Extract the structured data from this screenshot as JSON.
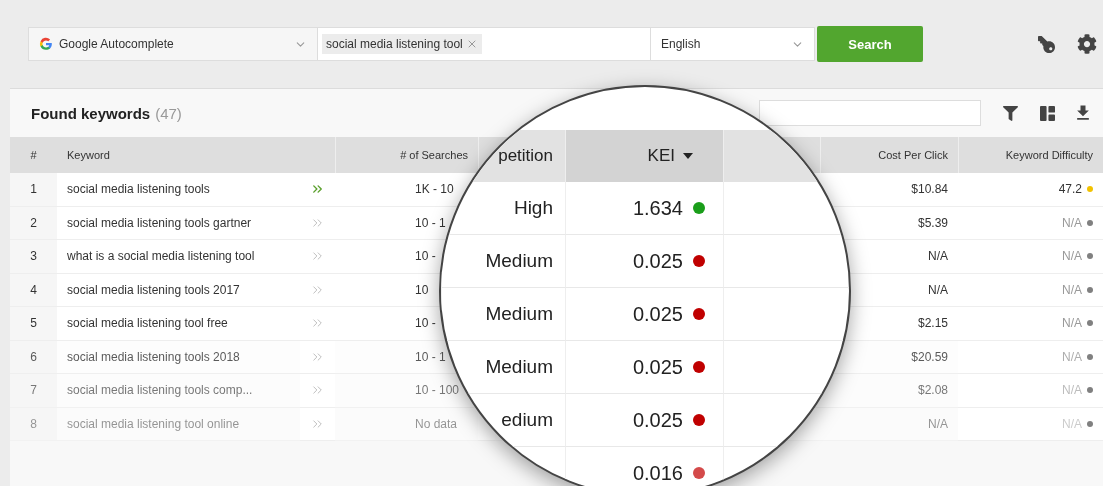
{
  "toolbar": {
    "source": "Google Autocomplete",
    "keyword_tags": [
      "social media listening tool"
    ],
    "language": "English",
    "search_button": "Search"
  },
  "results": {
    "title": "Found keywords",
    "count": "(47)",
    "columns": [
      "#",
      "Keyword",
      "# of Searches",
      "Cost Per Click",
      "Keyword Difficulty"
    ],
    "rows": [
      {
        "index": "1",
        "keyword": "social media listening tools",
        "active": true,
        "searches": "1K - 10",
        "cost_per_click": "$10.84",
        "difficulty": "47.2",
        "color": "#f2c200"
      },
      {
        "index": "2",
        "keyword": "social media listening tools gartner",
        "active": false,
        "searches": "10 - 1",
        "cost_per_click": "$5.39",
        "difficulty": "N/A",
        "color": "#808080"
      },
      {
        "index": "3",
        "keyword": "what is a social media listening tool",
        "active": false,
        "searches": "10 -",
        "cost_per_click": "N/A",
        "difficulty": "N/A",
        "color": "#808080"
      },
      {
        "index": "4",
        "keyword": "social media listening tools 2017",
        "active": false,
        "searches": "10",
        "cost_per_click": "N/A",
        "difficulty": "N/A",
        "color": "#808080"
      },
      {
        "index": "5",
        "keyword": "social media listening tool free",
        "active": false,
        "searches": "10 -",
        "cost_per_click": "$2.15",
        "difficulty": "N/A",
        "color": "#808080"
      },
      {
        "index": "6",
        "keyword": "social media listening tools 2018",
        "active": false,
        "searches": "10 - 1",
        "cost_per_click": "$20.59",
        "difficulty": "N/A",
        "color": "#808080"
      },
      {
        "index": "7",
        "keyword": "social media listening tools comp...",
        "active": false,
        "searches": "10 - 100",
        "cost_per_click": "$2.08",
        "difficulty": "N/A",
        "color": "#808080"
      },
      {
        "index": "8",
        "keyword": "social media listening tool online",
        "active": false,
        "searches": "No data",
        "cost_per_click": "N/A",
        "difficulty": "N/A",
        "color": "#808080"
      }
    ]
  },
  "magnifier": {
    "columns": [
      {
        "label": "petition",
        "sorted": false
      },
      {
        "label": "KEI",
        "sorted": true
      }
    ],
    "rows": [
      {
        "competition": "High",
        "kei": "1.634",
        "color": "#1a9e1a"
      },
      {
        "competition": "Medium",
        "kei": "0.025",
        "color": "#c00000"
      },
      {
        "competition": "Medium",
        "kei": "0.025",
        "color": "#c00000"
      },
      {
        "competition": "Medium",
        "kei": "0.025",
        "color": "#c00000"
      },
      {
        "competition": "edium",
        "kei": "0.025",
        "color": "#c00000"
      },
      {
        "kei": "0.016",
        "color": "#d44a4a"
      }
    ]
  }
}
